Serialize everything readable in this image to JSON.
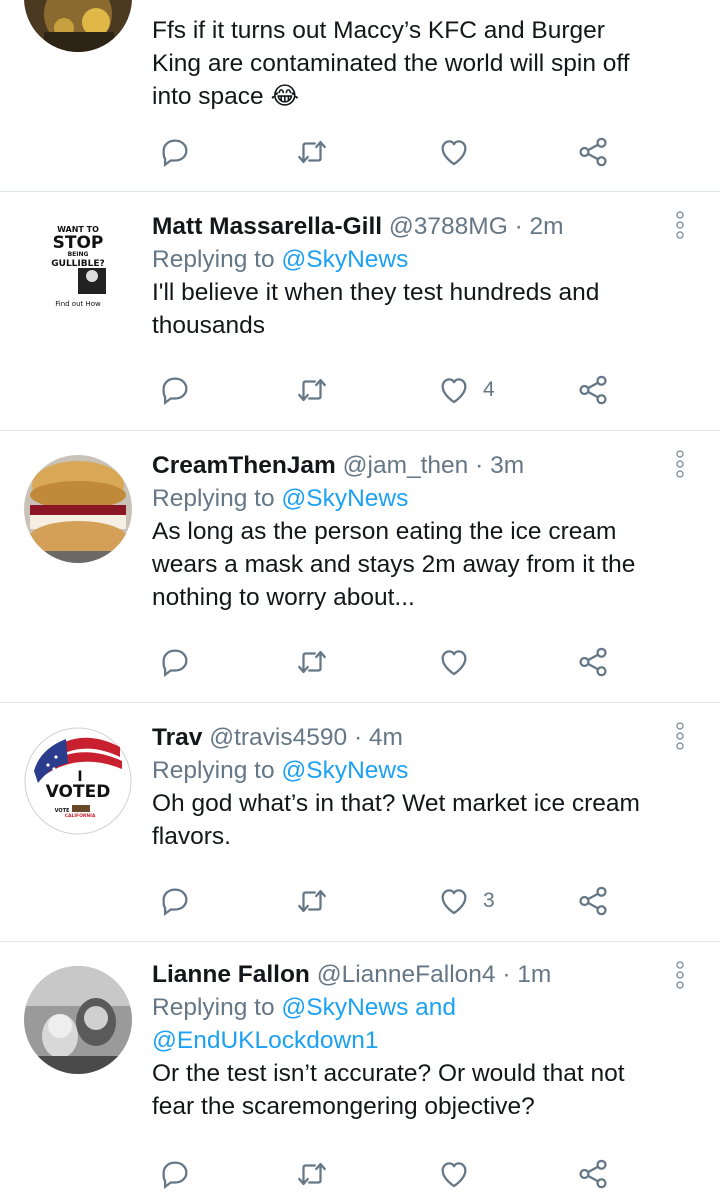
{
  "tweets": [
    {
      "text": "Ffs if it turns out Maccy’s KFC and Burger King are contaminated the world will spin off into space 😂"
    },
    {
      "name": "Matt Massarella-Gill",
      "handle": "@3788MG",
      "time": "· 2m",
      "replying_prefix": "Replying to",
      "replying_to": "@SkyNews",
      "text": "I'll believe it when they test hundreds and thousands",
      "like_count": "4",
      "avatar_text": {
        "top": "WANT TO",
        "stop": "STOP",
        "being": "BEING",
        "gullible": "GULLIBLE?",
        "find": "Find out How"
      }
    },
    {
      "name": "CreamThenJam",
      "handle": "@jam_then",
      "time": "· 3m",
      "replying_prefix": "Replying to",
      "replying_to": "@SkyNews",
      "text": "As long as the person eating the ice cream wears a mask and stays 2m away from it the nothing to worry about...",
      "like_count": ""
    },
    {
      "name": "Trav",
      "handle": "@travis4590",
      "time": "· 4m",
      "replying_prefix": "Replying to",
      "replying_to": "@SkyNews",
      "text": "Oh god what’s in that? Wet market ice cream flavors.",
      "like_count": "3",
      "avatar_text": {
        "i": "I",
        "voted": "VOTED",
        "vote": "VOTE",
        "state": "CALIFORNIA"
      }
    },
    {
      "name": "Lianne Fallon",
      "handle": "@LianneFallon4",
      "time": "· 1m",
      "replying_prefix": "Replying to",
      "replying_to": "@SkyNews and @EndUKLockdown1",
      "text": "Or the test isn’t accurate? Or would that not fear the scaremongering objective?"
    }
  ],
  "colors": {
    "link": "#1da1f2",
    "secondary": "#657786",
    "icon": "#657786",
    "divider": "#e1e8ed"
  },
  "icons": [
    "reply-icon",
    "retweet-icon",
    "like-icon",
    "share-icon",
    "more-options-icon"
  ]
}
